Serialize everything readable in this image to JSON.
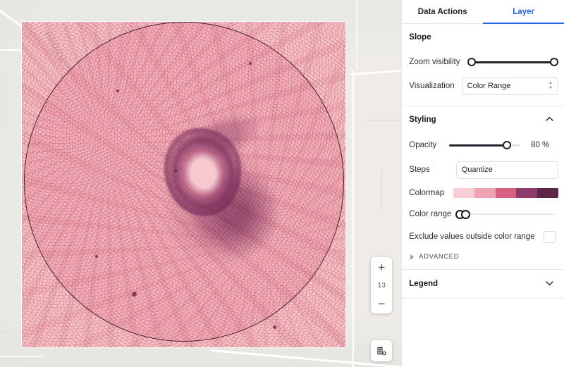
{
  "map": {
    "street_label_1": "Mandarin Dr",
    "street_label_2": "",
    "zoom_controls": {
      "zoom_in_label": "+",
      "zoom_level": "13",
      "zoom_out_label": "−",
      "layers_icon": "map-layers-icon"
    },
    "raster": {
      "fill_color": "#fad2d3",
      "circle_border_color": "#4a2338",
      "feature": "slope raster circular extent"
    }
  },
  "panel": {
    "tabs": [
      {
        "label": "Data Actions",
        "active": false
      },
      {
        "label": "Layer",
        "active": true
      }
    ],
    "accent_color": "#2563eb",
    "layer": {
      "title": "Slope",
      "zoom_visibility": {
        "label": "Zoom visibility",
        "min_pct": 0,
        "max_pct": 100
      },
      "visualization": {
        "label": "Visualization",
        "value": "Color Range",
        "icon": "stepper-icon"
      }
    },
    "styling": {
      "title": "Styling",
      "collapse_icon": "chevron-up-icon",
      "expanded": true,
      "opacity": {
        "label": "Opacity",
        "value": "80 %",
        "percent": 80
      },
      "steps": {
        "label": "Steps",
        "value": "Quantize"
      },
      "colormap": {
        "label": "Colormap",
        "swatches": [
          "#f9cdd4",
          "#efa2b1",
          "#d86181",
          "#8e3a6b",
          "#5e2547"
        ]
      },
      "color_range": {
        "label": "Color range",
        "low_pct": 0,
        "high_pct": 7
      },
      "exclude": {
        "label": "Exclude values outside color range",
        "checked": false
      },
      "advanced": {
        "label": "ADVANCED",
        "icon": "triangle-right-icon",
        "expanded": false
      }
    },
    "legend": {
      "title": "Legend",
      "collapse_icon": "chevron-down-icon",
      "expanded": false
    }
  }
}
